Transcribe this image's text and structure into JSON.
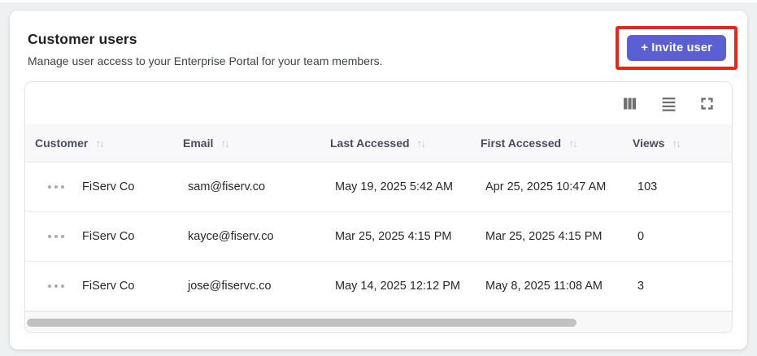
{
  "header": {
    "title": "Customer users",
    "subtitle": "Manage user access to your Enterprise Portal for your team members.",
    "invite_button_label": "+ Invite user"
  },
  "toolbar": {
    "icon_names": [
      "show-hide-columns",
      "toggle-density",
      "toggle-full-screen"
    ]
  },
  "icons": {
    "sort": "↑↓"
  },
  "table": {
    "columns": [
      {
        "label": "Customer"
      },
      {
        "label": "Email"
      },
      {
        "label": "Last Accessed"
      },
      {
        "label": "First Accessed"
      },
      {
        "label": "Views"
      }
    ],
    "rows": [
      {
        "customer": "FiServ Co",
        "email": "sam@fiserv.co",
        "last_accessed": "May 19, 2025 5:42 AM",
        "first_accessed": "Apr 25, 2025 10:47 AM",
        "views": "103"
      },
      {
        "customer": "FiServ Co",
        "email": "kayce@fiserv.co",
        "last_accessed": "Mar 25, 2025 4:15 PM",
        "first_accessed": "Mar 25, 2025 4:15 PM",
        "views": "0"
      },
      {
        "customer": "FiServ Co",
        "email": "jose@fiservc.co",
        "last_accessed": "May 14, 2025 12:12 PM",
        "first_accessed": "May 8, 2025 11:08 AM",
        "views": "3"
      }
    ]
  },
  "colors": {
    "accent": "#5a60d4",
    "annotation_highlight": "#e8271a",
    "header_row_bg": "#f8f8fb",
    "page_bg": "#edf1f1",
    "card_bg": "#ffffff"
  }
}
